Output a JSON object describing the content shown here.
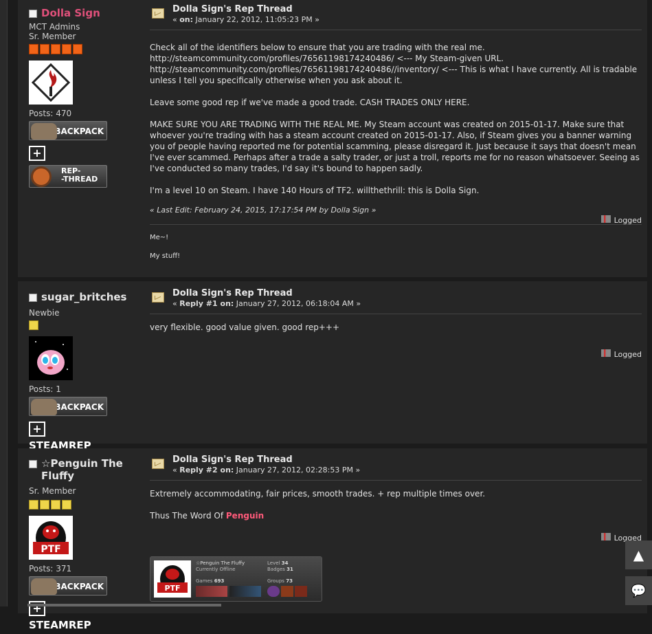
{
  "posts": [
    {
      "user": {
        "name": "Dolla Sign",
        "name_color": "#e0507a",
        "group": "MCT Admins",
        "rank": "Sr. Member",
        "posts": "Posts: 470"
      },
      "subject": "Dolla Sign's Rep Thread",
      "meta_prefix": "« ",
      "meta_label": "on:",
      "meta_date": "January 22, 2012, 11:05:23 PM »",
      "body": [
        "Check all of the identifiers below to ensure that you are trading with the real me.",
        "http://steamcommunity.com/profiles/76561198174240486/ <--- My Steam-given URL.",
        "http://steamcommunity.com/profiles/76561198174240486//inventory/ <--- This is what I have currently. All is tradable unless I tell you specifically otherwise when you ask about it.",
        "Leave some good rep if we've made a good trade. CASH TRADES ONLY HERE.",
        "MAKE SURE YOU ARE TRADING WITH THE REAL ME. My Steam account was created on 2015-01-17. Make sure that whoever you're trading with has a steam account created on 2015-01-17. Also, if Steam gives you a banner warning you of people having reported me for potential scamming, please disregard it. Just because it says that doesn't mean I've ever scammed. Perhaps after a trade a salty trader, or just a troll, reports me for no reason whatsoever. Seeing as I've conducted so many trades, I'd say it's bound to happen sadly.",
        "I'm a level 10 on Steam. I have 140 Hours of TF2. willthethrill: this is Dolla Sign."
      ],
      "last_edit": "« Last Edit: February 24, 2015, 17:17:54 PM by Dolla Sign »",
      "logged": "Logged",
      "signature": [
        "Me~!",
        "My stuff!"
      ]
    },
    {
      "user": {
        "name": "sugar_britches",
        "rank": "Newbie",
        "posts": "Posts: 1"
      },
      "subject": "Dolla Sign's Rep Thread",
      "meta_prefix": "« ",
      "meta_label": "Reply #1 on:",
      "meta_date": "January 27, 2012, 06:18:04 AM »",
      "body": [
        "very flexible. good value given. good rep+++"
      ],
      "logged": "Logged"
    },
    {
      "user": {
        "name": "☆Penguin The Fluffy",
        "rank": "Sr. Member",
        "posts": "Posts: 371"
      },
      "subject": "Dolla Sign's Rep Thread",
      "meta_prefix": "« ",
      "meta_label": "Reply #2 on:",
      "meta_date": "January 27, 2012, 02:28:53 PM »",
      "body": [
        "Extremely accommodating, fair prices, smooth trades. + rep multiple times over."
      ],
      "sig_prefix": "Thus The Word Of ",
      "sig_name": "Penguin",
      "logged": "Logged",
      "steam_card": {
        "name": "☆Penguin The Fluffy",
        "status": "Currently Offline",
        "level_label": "Level",
        "level": "34",
        "badges_label": "Badges",
        "badges": "31",
        "games_label": "Games",
        "games": "693",
        "groups_label": "Groups",
        "groups": "73",
        "avatar_text": "PTF"
      }
    }
  ],
  "badges": {
    "backpack": "BACKPACK",
    "steamrep": "STEAMREP",
    "steamrep_plus": "+",
    "rep_thread_1": "REP-",
    "rep_thread_2": "-THREAD"
  },
  "avatar_ptf": "PTF",
  "colors": {
    "accent_name": "#e0507a",
    "signature_name": "#ff5a7a",
    "rank_orange": "#f26418",
    "rank_yellow": "#efd64a"
  }
}
